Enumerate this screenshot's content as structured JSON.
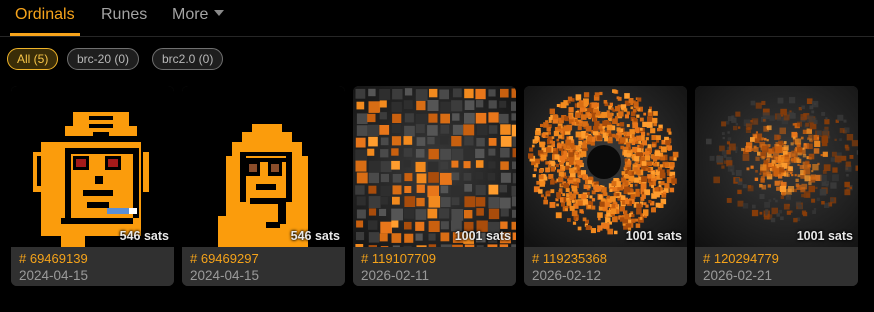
{
  "tabs": [
    {
      "label": "Ordinals",
      "active": true
    },
    {
      "label": "Runes",
      "active": false
    },
    {
      "label": "More",
      "active": false,
      "icon": "chevron-down-icon"
    }
  ],
  "filters": [
    {
      "label": "All (5)",
      "active": true
    },
    {
      "label": "brc-20 (0)",
      "active": false
    },
    {
      "label": "brc2.0 (0)",
      "active": false
    }
  ],
  "inscriptions": [
    {
      "number": "# 69469139",
      "date": "2024-04-15",
      "sats": "546 sats",
      "image": "orange-pixel-punk-cap"
    },
    {
      "number": "# 69469297",
      "date": "2024-04-15",
      "sats": "546 sats",
      "image": "orange-pixel-punk-hood"
    },
    {
      "number": "# 119107709",
      "date": "2026-02-11",
      "sats": "1001 sats",
      "image": "orange-cube-wall"
    },
    {
      "number": "# 119235368",
      "date": "2026-02-12",
      "sats": "1001 sats",
      "image": "orange-cube-ring"
    },
    {
      "number": "# 120294779",
      "date": "2026-02-21",
      "sats": "1001 sats",
      "image": "orange-cube-burst"
    }
  ],
  "colors": {
    "accent": "#f7a41b",
    "background": "#000000",
    "card": "#303030"
  }
}
